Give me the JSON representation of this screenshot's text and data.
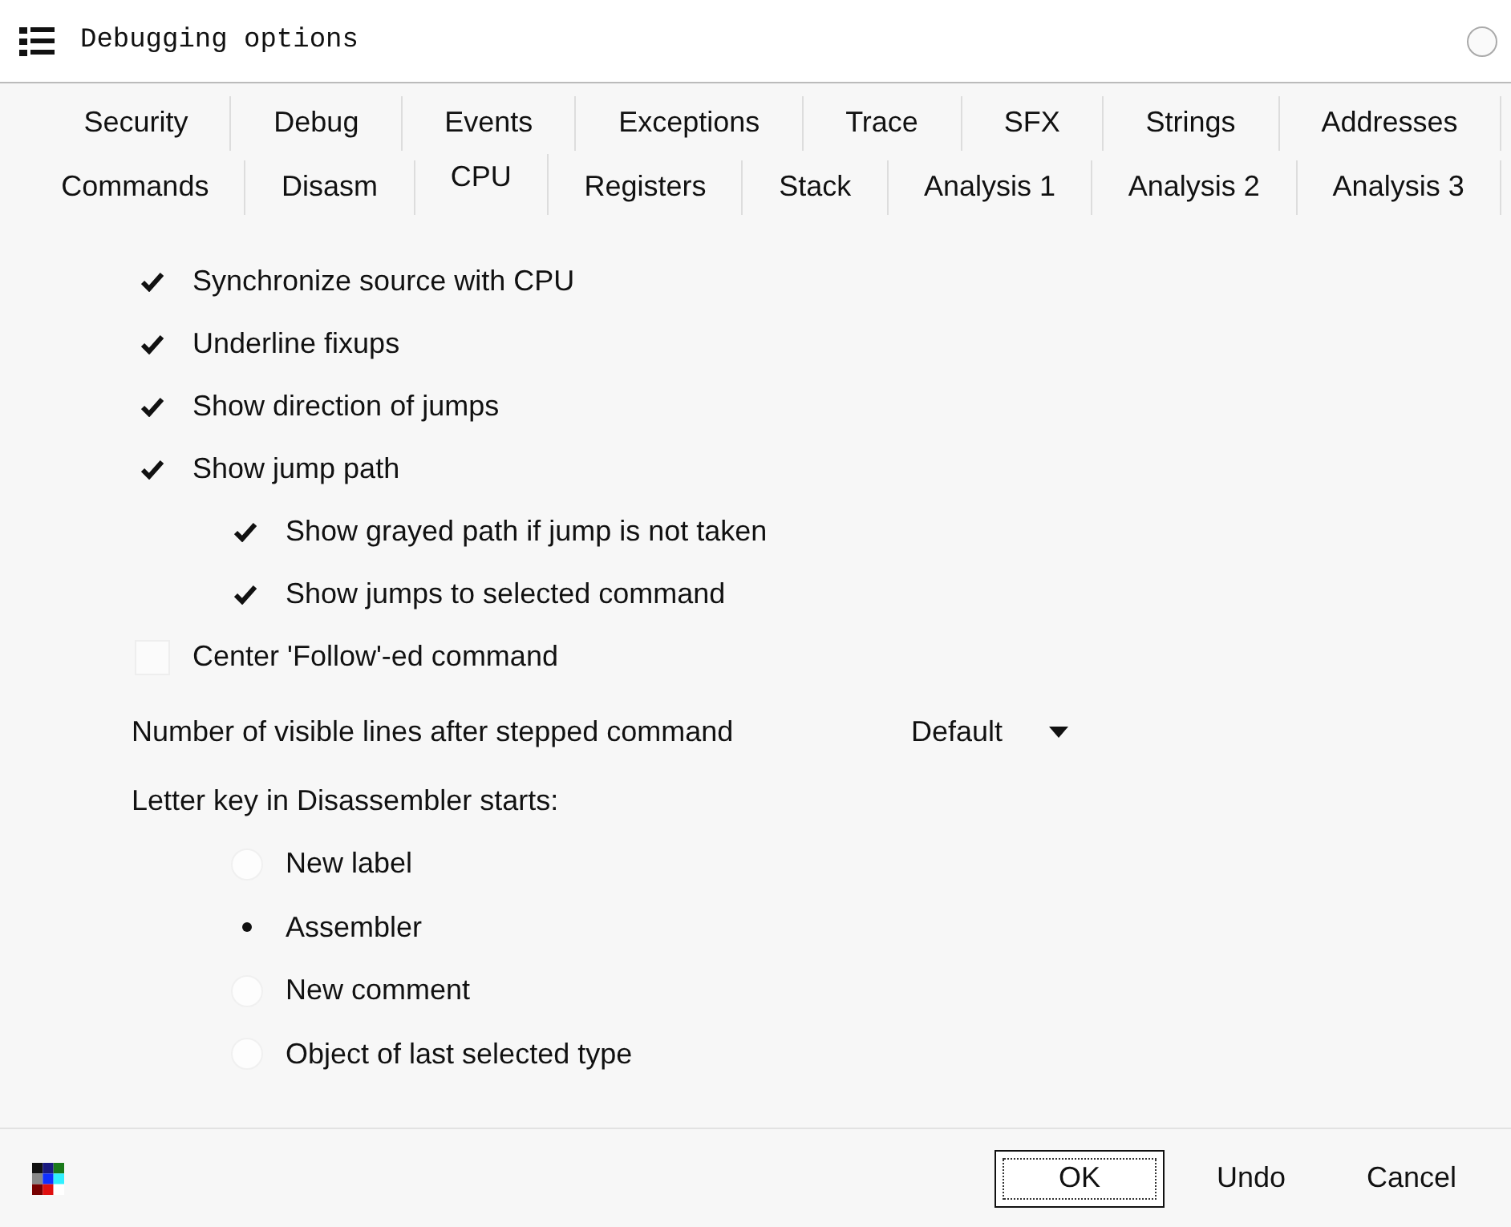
{
  "window": {
    "title": "Debugging options"
  },
  "tab_rows": [
    [
      {
        "label": "Security",
        "selected": false
      },
      {
        "label": "Debug",
        "selected": false
      },
      {
        "label": "Events",
        "selected": false
      },
      {
        "label": "Exceptions",
        "selected": false
      },
      {
        "label": "Trace",
        "selected": false
      },
      {
        "label": "SFX",
        "selected": false
      },
      {
        "label": "Strings",
        "selected": false
      },
      {
        "label": "Addresses",
        "selected": false
      }
    ],
    [
      {
        "label": "Commands",
        "selected": false
      },
      {
        "label": "Disasm",
        "selected": false
      },
      {
        "label": "CPU",
        "selected": true
      },
      {
        "label": "Registers",
        "selected": false
      },
      {
        "label": "Stack",
        "selected": false
      },
      {
        "label": "Analysis 1",
        "selected": false
      },
      {
        "label": "Analysis 2",
        "selected": false
      },
      {
        "label": "Analysis 3",
        "selected": false
      }
    ]
  ],
  "options": [
    {
      "label": "Synchronize source with CPU",
      "checked": true
    },
    {
      "label": "Underline fixups",
      "checked": true
    },
    {
      "label": "Show direction of jumps",
      "checked": true
    },
    {
      "label": "Show jump path",
      "checked": true,
      "children": [
        {
          "label": "Show grayed path if jump is not taken",
          "checked": true
        },
        {
          "label": "Show jumps to selected command",
          "checked": true
        }
      ]
    },
    {
      "label": "Center 'Follow'-ed command",
      "checked": false
    }
  ],
  "visible_lines": {
    "label": "Number of visible lines after stepped command",
    "value": "Default"
  },
  "letter_key": {
    "label": "Letter key in Disassembler starts:",
    "choices": [
      {
        "label": "New label",
        "selected": false
      },
      {
        "label": "Assembler",
        "selected": true
      },
      {
        "label": "New comment",
        "selected": false
      },
      {
        "label": "Object of last selected type",
        "selected": false
      }
    ]
  },
  "buttons": [
    {
      "label": "OK",
      "default": true
    },
    {
      "label": "Undo",
      "default": false
    },
    {
      "label": "Cancel",
      "default": false
    }
  ]
}
